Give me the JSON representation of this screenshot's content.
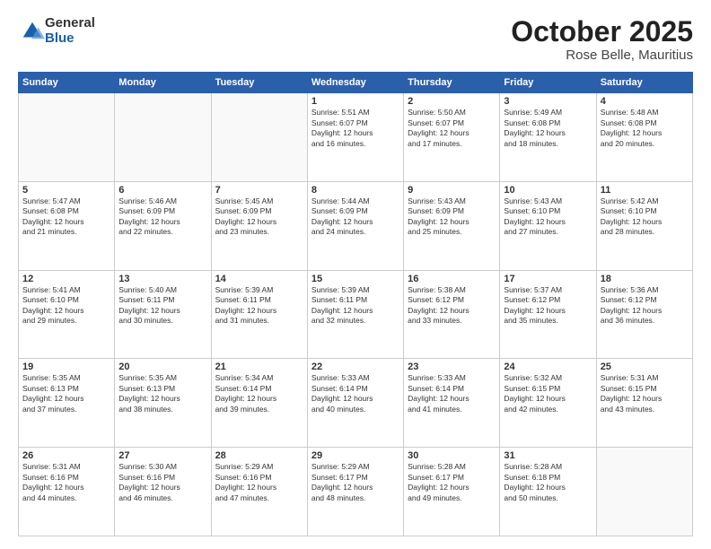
{
  "header": {
    "logo_general": "General",
    "logo_blue": "Blue",
    "month": "October 2025",
    "location": "Rose Belle, Mauritius"
  },
  "days_of_week": [
    "Sunday",
    "Monday",
    "Tuesday",
    "Wednesday",
    "Thursday",
    "Friday",
    "Saturday"
  ],
  "weeks": [
    [
      {
        "day": "",
        "lines": []
      },
      {
        "day": "",
        "lines": []
      },
      {
        "day": "",
        "lines": []
      },
      {
        "day": "1",
        "lines": [
          "Sunrise: 5:51 AM",
          "Sunset: 6:07 PM",
          "Daylight: 12 hours",
          "and 16 minutes."
        ]
      },
      {
        "day": "2",
        "lines": [
          "Sunrise: 5:50 AM",
          "Sunset: 6:07 PM",
          "Daylight: 12 hours",
          "and 17 minutes."
        ]
      },
      {
        "day": "3",
        "lines": [
          "Sunrise: 5:49 AM",
          "Sunset: 6:08 PM",
          "Daylight: 12 hours",
          "and 18 minutes."
        ]
      },
      {
        "day": "4",
        "lines": [
          "Sunrise: 5:48 AM",
          "Sunset: 6:08 PM",
          "Daylight: 12 hours",
          "and 20 minutes."
        ]
      }
    ],
    [
      {
        "day": "5",
        "lines": [
          "Sunrise: 5:47 AM",
          "Sunset: 6:08 PM",
          "Daylight: 12 hours",
          "and 21 minutes."
        ]
      },
      {
        "day": "6",
        "lines": [
          "Sunrise: 5:46 AM",
          "Sunset: 6:09 PM",
          "Daylight: 12 hours",
          "and 22 minutes."
        ]
      },
      {
        "day": "7",
        "lines": [
          "Sunrise: 5:45 AM",
          "Sunset: 6:09 PM",
          "Daylight: 12 hours",
          "and 23 minutes."
        ]
      },
      {
        "day": "8",
        "lines": [
          "Sunrise: 5:44 AM",
          "Sunset: 6:09 PM",
          "Daylight: 12 hours",
          "and 24 minutes."
        ]
      },
      {
        "day": "9",
        "lines": [
          "Sunrise: 5:43 AM",
          "Sunset: 6:09 PM",
          "Daylight: 12 hours",
          "and 25 minutes."
        ]
      },
      {
        "day": "10",
        "lines": [
          "Sunrise: 5:43 AM",
          "Sunset: 6:10 PM",
          "Daylight: 12 hours",
          "and 27 minutes."
        ]
      },
      {
        "day": "11",
        "lines": [
          "Sunrise: 5:42 AM",
          "Sunset: 6:10 PM",
          "Daylight: 12 hours",
          "and 28 minutes."
        ]
      }
    ],
    [
      {
        "day": "12",
        "lines": [
          "Sunrise: 5:41 AM",
          "Sunset: 6:10 PM",
          "Daylight: 12 hours",
          "and 29 minutes."
        ]
      },
      {
        "day": "13",
        "lines": [
          "Sunrise: 5:40 AM",
          "Sunset: 6:11 PM",
          "Daylight: 12 hours",
          "and 30 minutes."
        ]
      },
      {
        "day": "14",
        "lines": [
          "Sunrise: 5:39 AM",
          "Sunset: 6:11 PM",
          "Daylight: 12 hours",
          "and 31 minutes."
        ]
      },
      {
        "day": "15",
        "lines": [
          "Sunrise: 5:39 AM",
          "Sunset: 6:11 PM",
          "Daylight: 12 hours",
          "and 32 minutes."
        ]
      },
      {
        "day": "16",
        "lines": [
          "Sunrise: 5:38 AM",
          "Sunset: 6:12 PM",
          "Daylight: 12 hours",
          "and 33 minutes."
        ]
      },
      {
        "day": "17",
        "lines": [
          "Sunrise: 5:37 AM",
          "Sunset: 6:12 PM",
          "Daylight: 12 hours",
          "and 35 minutes."
        ]
      },
      {
        "day": "18",
        "lines": [
          "Sunrise: 5:36 AM",
          "Sunset: 6:12 PM",
          "Daylight: 12 hours",
          "and 36 minutes."
        ]
      }
    ],
    [
      {
        "day": "19",
        "lines": [
          "Sunrise: 5:35 AM",
          "Sunset: 6:13 PM",
          "Daylight: 12 hours",
          "and 37 minutes."
        ]
      },
      {
        "day": "20",
        "lines": [
          "Sunrise: 5:35 AM",
          "Sunset: 6:13 PM",
          "Daylight: 12 hours",
          "and 38 minutes."
        ]
      },
      {
        "day": "21",
        "lines": [
          "Sunrise: 5:34 AM",
          "Sunset: 6:14 PM",
          "Daylight: 12 hours",
          "and 39 minutes."
        ]
      },
      {
        "day": "22",
        "lines": [
          "Sunrise: 5:33 AM",
          "Sunset: 6:14 PM",
          "Daylight: 12 hours",
          "and 40 minutes."
        ]
      },
      {
        "day": "23",
        "lines": [
          "Sunrise: 5:33 AM",
          "Sunset: 6:14 PM",
          "Daylight: 12 hours",
          "and 41 minutes."
        ]
      },
      {
        "day": "24",
        "lines": [
          "Sunrise: 5:32 AM",
          "Sunset: 6:15 PM",
          "Daylight: 12 hours",
          "and 42 minutes."
        ]
      },
      {
        "day": "25",
        "lines": [
          "Sunrise: 5:31 AM",
          "Sunset: 6:15 PM",
          "Daylight: 12 hours",
          "and 43 minutes."
        ]
      }
    ],
    [
      {
        "day": "26",
        "lines": [
          "Sunrise: 5:31 AM",
          "Sunset: 6:16 PM",
          "Daylight: 12 hours",
          "and 44 minutes."
        ]
      },
      {
        "day": "27",
        "lines": [
          "Sunrise: 5:30 AM",
          "Sunset: 6:16 PM",
          "Daylight: 12 hours",
          "and 46 minutes."
        ]
      },
      {
        "day": "28",
        "lines": [
          "Sunrise: 5:29 AM",
          "Sunset: 6:16 PM",
          "Daylight: 12 hours",
          "and 47 minutes."
        ]
      },
      {
        "day": "29",
        "lines": [
          "Sunrise: 5:29 AM",
          "Sunset: 6:17 PM",
          "Daylight: 12 hours",
          "and 48 minutes."
        ]
      },
      {
        "day": "30",
        "lines": [
          "Sunrise: 5:28 AM",
          "Sunset: 6:17 PM",
          "Daylight: 12 hours",
          "and 49 minutes."
        ]
      },
      {
        "day": "31",
        "lines": [
          "Sunrise: 5:28 AM",
          "Sunset: 6:18 PM",
          "Daylight: 12 hours",
          "and 50 minutes."
        ]
      },
      {
        "day": "",
        "lines": []
      }
    ]
  ]
}
